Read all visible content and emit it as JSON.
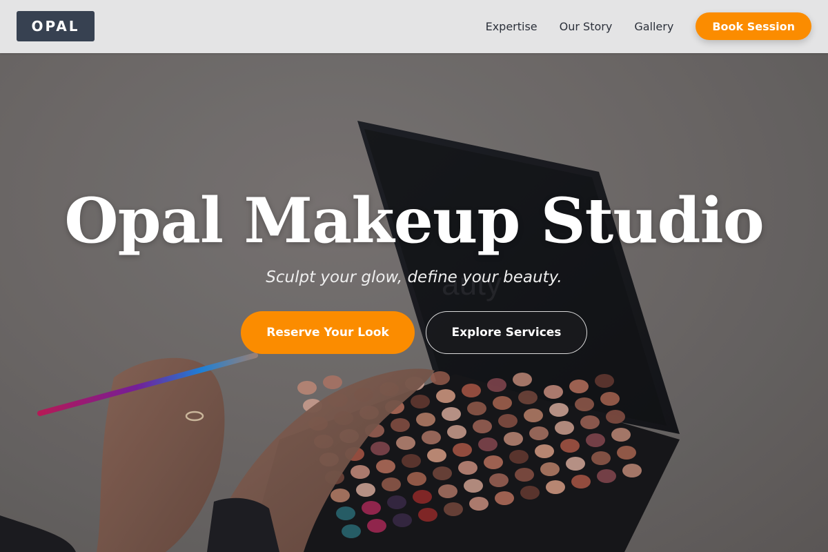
{
  "header": {
    "logo_text": "OPAL",
    "nav": [
      {
        "label": "Expertise"
      },
      {
        "label": "Our Story"
      },
      {
        "label": "Gallery"
      }
    ],
    "cta_label": "Book Session"
  },
  "hero": {
    "title": "Opal Makeup Studio",
    "subtitle": "Sculpt your glow, define your beauty.",
    "primary_button": "Reserve Your Look",
    "secondary_button": "Explore Services",
    "background_image": "makeup eyeshadow palette held in hand with applicator brush"
  },
  "colors": {
    "accent": "#fb8c00",
    "logo_bg": "#374151",
    "header_bg": "#e4e4e5",
    "nav_text": "#2b303a"
  }
}
